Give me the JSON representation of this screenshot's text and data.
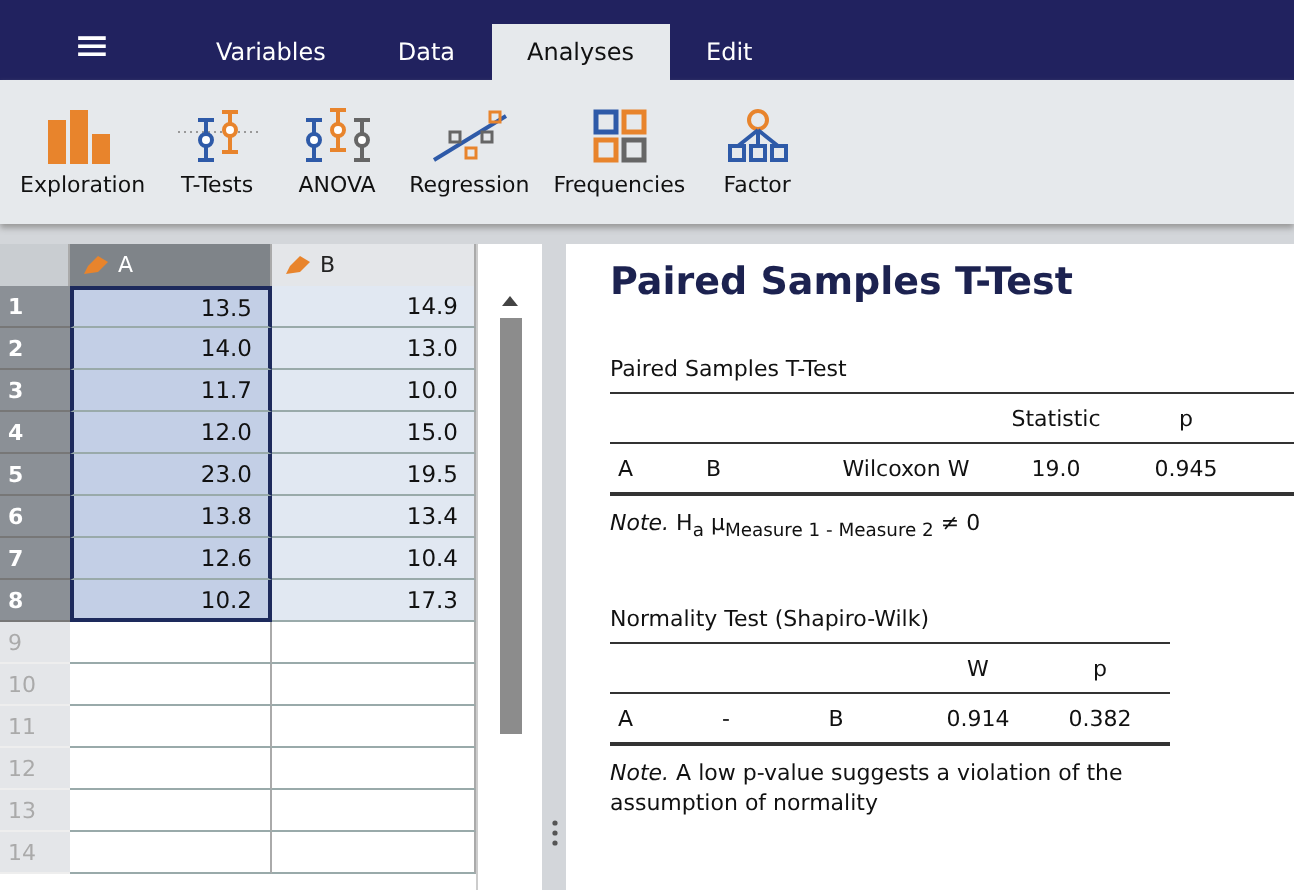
{
  "menu_button": "≡",
  "tabs": [
    {
      "label": "Variables",
      "selected": false
    },
    {
      "label": "Data",
      "selected": false
    },
    {
      "label": "Analyses",
      "selected": true
    },
    {
      "label": "Edit",
      "selected": false
    }
  ],
  "toolbar": [
    {
      "label": "Exploration",
      "kind": "bars"
    },
    {
      "label": "T-Tests",
      "kind": "ttest"
    },
    {
      "label": "ANOVA",
      "kind": "anova"
    },
    {
      "label": "Regression",
      "kind": "regression"
    },
    {
      "label": "Frequencies",
      "kind": "frequencies"
    },
    {
      "label": "Factor",
      "kind": "factor"
    }
  ],
  "spreadsheet": {
    "columns": [
      {
        "name": "A",
        "selected": true
      },
      {
        "name": "B",
        "selected": false
      }
    ],
    "rows": [
      {
        "number": "1",
        "cells": [
          "13.5",
          "14.9"
        ]
      },
      {
        "number": "2",
        "cells": [
          "14.0",
          "13.0"
        ]
      },
      {
        "number": "3",
        "cells": [
          "11.7",
          "10.0"
        ]
      },
      {
        "number": "4",
        "cells": [
          "12.0",
          "15.0"
        ]
      },
      {
        "number": "5",
        "cells": [
          "23.0",
          "19.5"
        ]
      },
      {
        "number": "6",
        "cells": [
          "13.8",
          "13.4"
        ]
      },
      {
        "number": "7",
        "cells": [
          "12.6",
          "10.4"
        ]
      },
      {
        "number": "8",
        "cells": [
          "10.2",
          "17.3"
        ]
      },
      {
        "number": "9"
      },
      {
        "number": "10"
      },
      {
        "number": "11"
      },
      {
        "number": "12"
      },
      {
        "number": "13"
      },
      {
        "number": "14"
      }
    ]
  },
  "results": {
    "heading": "Paired Samples T-Test",
    "tables": [
      {
        "title": "Paired Samples T-Test",
        "columns": [
          "",
          "",
          "",
          "Statistic",
          "p"
        ],
        "rows": [
          [
            "A",
            "B",
            "Wilcoxon W",
            "19.0",
            "0.945"
          ]
        ],
        "note": "*Note.* H$_{a}$ μ$_{Measure 1 - Measure 2}$ ≠ 0"
      },
      {
        "title": "Normality Test (Shapiro-Wilk)",
        "columns": [
          "",
          "",
          "",
          "W",
          "p"
        ],
        "rows": [
          [
            "A",
            "-",
            "B",
            "0.914",
            "0.382"
          ]
        ],
        "note": "*Note.* A low p-value suggests a violation of the assumption of normality"
      }
    ]
  }
}
